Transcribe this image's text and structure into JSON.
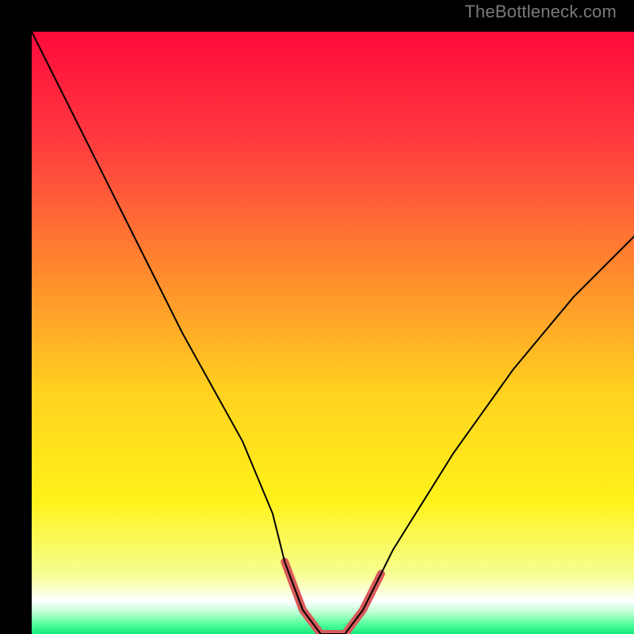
{
  "credit": "TheBottleneck.com",
  "chart_data": {
    "type": "line",
    "title": "",
    "xlabel": "",
    "ylabel": "",
    "xlim": [
      0,
      100
    ],
    "ylim": [
      0,
      100
    ],
    "grid": false,
    "legend": false,
    "series": [
      {
        "name": "curve",
        "x": [
          0,
          5,
          10,
          15,
          20,
          25,
          30,
          35,
          40,
          42,
          45,
          48,
          52,
          55,
          58,
          60,
          65,
          70,
          75,
          80,
          85,
          90,
          95,
          100
        ],
        "y": [
          100,
          90,
          80,
          70,
          60,
          50,
          41,
          32,
          20,
          12,
          4,
          0,
          0,
          4,
          10,
          14,
          22,
          30,
          37,
          44,
          50,
          56,
          61,
          66
        ],
        "stroke": "#000000",
        "width": 2
      },
      {
        "name": "highlight",
        "x": [
          40,
          42,
          45,
          48,
          52,
          55,
          58,
          60
        ],
        "y": [
          20,
          12,
          4,
          0,
          0,
          4,
          10,
          14
        ],
        "stroke": "#d85a5a",
        "width": 10,
        "visible_segment_only": true,
        "segment_xrange": [
          41,
          59
        ]
      }
    ],
    "background_gradient": {
      "stops": [
        {
          "offset": 0.0,
          "color": "#ff0a3a"
        },
        {
          "offset": 0.18,
          "color": "#ff3a3f"
        },
        {
          "offset": 0.4,
          "color": "#ff8a2e"
        },
        {
          "offset": 0.6,
          "color": "#ffd21f"
        },
        {
          "offset": 0.78,
          "color": "#fff21a"
        },
        {
          "offset": 0.9,
          "color": "#f6ff90"
        },
        {
          "offset": 0.945,
          "color": "#ffffff"
        },
        {
          "offset": 0.965,
          "color": "#b8ffd0"
        },
        {
          "offset": 0.985,
          "color": "#4cff9a"
        },
        {
          "offset": 1.0,
          "color": "#17e87a"
        }
      ]
    }
  }
}
